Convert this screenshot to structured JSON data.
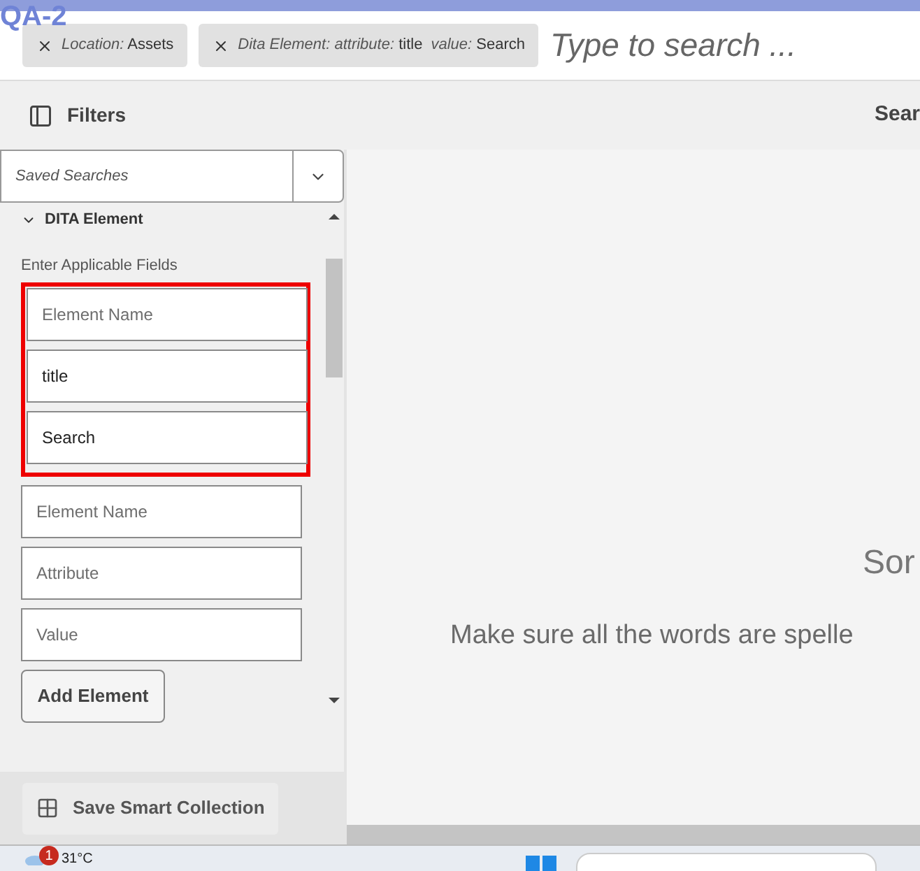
{
  "overlay_label": "QA-2",
  "tags": [
    {
      "parts": [
        {
          "label": "Location:",
          "value": "Assets"
        }
      ]
    },
    {
      "parts": [
        {
          "label": "Dita Element: attribute:",
          "value": "title"
        },
        {
          "label": "value:",
          "value": "Search"
        }
      ]
    }
  ],
  "search": {
    "placeholder": "Type to search ..."
  },
  "filters_label": "Filters",
  "right_header": "Sear",
  "saved_searches": {
    "placeholder": "Saved Searches"
  },
  "section": {
    "title": "DITA Element",
    "expanded": true,
    "hint": "Enter Applicable Fields"
  },
  "element_groups": [
    {
      "highlighted": true,
      "fields": [
        {
          "placeholder": "Element Name"
        },
        {
          "value": "title"
        },
        {
          "value": "Search"
        }
      ]
    },
    {
      "highlighted": false,
      "fields": [
        {
          "placeholder": "Element Name"
        },
        {
          "placeholder": "Attribute"
        },
        {
          "placeholder": "Value"
        }
      ]
    }
  ],
  "add_button": "Add Element",
  "save_button": "Save Smart Collection",
  "empty_title": "Sor",
  "empty_message": "Make sure all the words are spelle",
  "taskbar": {
    "badge": "1",
    "temperature": "31°C"
  }
}
